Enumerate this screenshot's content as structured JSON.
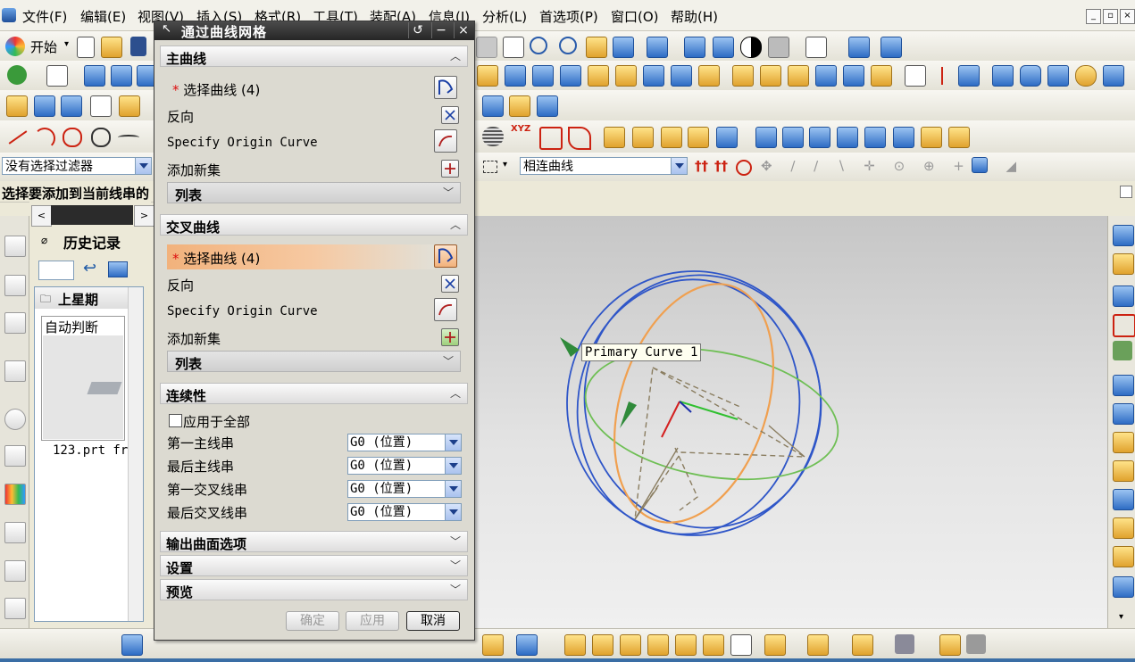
{
  "menu": {
    "items": [
      "文件(F)",
      "编辑(E)",
      "视图(V)",
      "插入(S)",
      "格式(R)",
      "工具(T)",
      "装配(A)",
      "信息(I)",
      "分析(L)",
      "首选项(P)",
      "窗口(O)",
      "帮助(H)"
    ]
  },
  "toolbar": {
    "start_label": "开始",
    "filter_value": "没有选择过滤器",
    "curve_rule_value": "相连曲线",
    "prompt": "选择要添加到当前线串的"
  },
  "history": {
    "title": "历史记录",
    "group_label": "上星期",
    "item_title": "自动判断",
    "item_file": "123.prt fr"
  },
  "dialog": {
    "title": "通过曲线网格",
    "primary": {
      "header": "主曲线",
      "select_label": "选择曲线 (4)",
      "reverse_label": "反向",
      "origin_label": "Specify Origin Curve",
      "add_set_label": "添加新集",
      "list_label": "列表"
    },
    "cross": {
      "header": "交叉曲线",
      "select_label": "选择曲线 (4)",
      "reverse_label": "反向",
      "origin_label": "Specify Origin Curve",
      "add_set_label": "添加新集",
      "list_label": "列表"
    },
    "continuity": {
      "header": "连续性",
      "apply_all_label": "应用于全部",
      "rows": [
        {
          "label": "第一主线串",
          "value": "G0 (位置)"
        },
        {
          "label": "最后主线串",
          "value": "G0 (位置)"
        },
        {
          "label": "第一交叉线串",
          "value": "G0 (位置)"
        },
        {
          "label": "最后交叉线串",
          "value": "G0 (位置)"
        }
      ]
    },
    "output_header": "输出曲面选项",
    "settings_header": "设置",
    "preview_header": "预览",
    "ok_label": "确定",
    "apply_label": "应用",
    "cancel_label": "取消",
    "required_marker": "*"
  },
  "viewport": {
    "tooltip": "Primary Curve  1"
  },
  "colors": {
    "primary_curve": "#2f56c8",
    "cross_curve": "#f0a050",
    "green_curve": "#6fbf55",
    "selection_highlight": "#f2b27c"
  }
}
